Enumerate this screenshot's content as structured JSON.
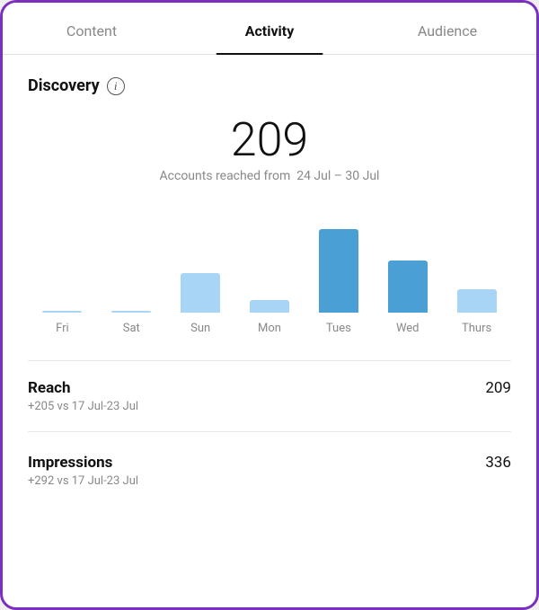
{
  "tabs": [
    {
      "id": "content",
      "label": "Content",
      "active": false
    },
    {
      "id": "activity",
      "label": "Activity",
      "active": true
    },
    {
      "id": "audience",
      "label": "Audience",
      "active": false
    }
  ],
  "discovery": {
    "title": "Discovery",
    "info_icon": "i",
    "big_number": "209",
    "date_label": "Accounts reached from",
    "date_range": "24 Jul – 30 Jul"
  },
  "chart": {
    "bars": [
      {
        "label": "Fri",
        "height_pct": 2,
        "style": "light"
      },
      {
        "label": "Sat",
        "height_pct": 2,
        "style": "light"
      },
      {
        "label": "Sun",
        "height_pct": 38,
        "style": "light"
      },
      {
        "label": "Mon",
        "height_pct": 12,
        "style": "light"
      },
      {
        "label": "Tues",
        "height_pct": 80,
        "style": "dark"
      },
      {
        "label": "Wed",
        "height_pct": 50,
        "style": "dark"
      },
      {
        "label": "Thurs",
        "height_pct": 22,
        "style": "light"
      }
    ]
  },
  "metrics": [
    {
      "id": "reach",
      "label": "Reach",
      "value": "209",
      "change": "+205 vs 17 Jul-23 Jul"
    },
    {
      "id": "impressions",
      "label": "Impressions",
      "value": "336",
      "change": "+292 vs 17 Jul-23 Jul"
    }
  ]
}
